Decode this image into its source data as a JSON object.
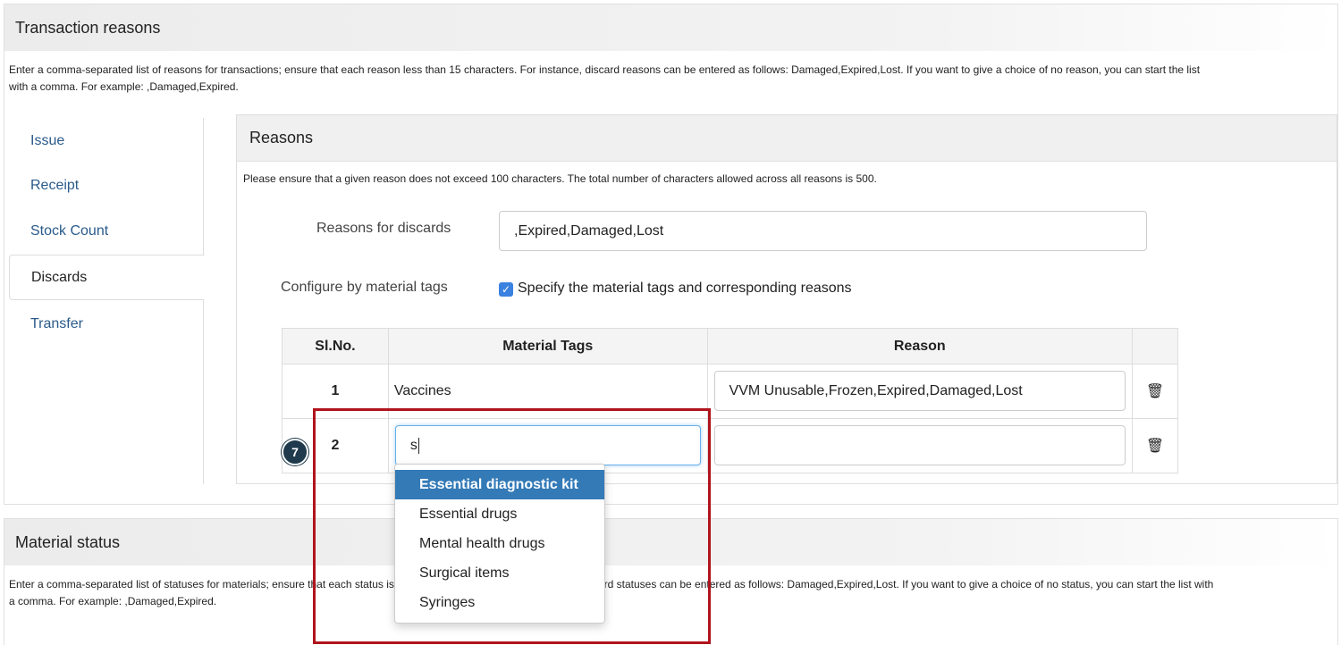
{
  "transaction_reasons": {
    "title": "Transaction reasons",
    "description": "Enter a comma-separated list of reasons for transactions; ensure that each reason less than 15 characters. For instance, discard reasons can be entered as follows: Damaged,Expired,Lost. If you want to give a choice of no reason, you can start the list with a comma. For example: ,Damaged,Expired."
  },
  "side_tabs": [
    {
      "label": "Issue"
    },
    {
      "label": "Receipt"
    },
    {
      "label": "Stock Count"
    },
    {
      "label": "Discards",
      "active": true
    },
    {
      "label": "Transfer"
    }
  ],
  "reasons_panel": {
    "title": "Reasons",
    "note": "Please ensure that a given reason does not exceed 100 characters. The total number of characters allowed across all reasons is 500.",
    "discards_label": "Reasons for discards",
    "discards_value": ",Expired,Damaged,Lost",
    "configure_label": "Configure by material tags",
    "configure_checkbox_label": "Specify the material tags and corresponding reasons",
    "configure_checked": true
  },
  "table": {
    "headers": [
      "Sl.No.",
      "Material Tags",
      "Reason",
      ""
    ],
    "rows": [
      {
        "num": "1",
        "tag": "Vaccines",
        "reason": "VVM Unusable,Frozen,Expired,Damaged,Lost"
      },
      {
        "num": "2",
        "tag": "s",
        "reason": ""
      }
    ]
  },
  "autocomplete": {
    "items": [
      "Essential diagnostic kit",
      "Essential drugs",
      "Mental health drugs",
      "Surgical items",
      "Syringes"
    ],
    "active_index": 0
  },
  "step_badge": "7",
  "material_status": {
    "title": "Material status",
    "description": "Enter a comma-separated list of statuses for materials; ensure that each status is less than 15 characters. For instance, discard statuses can be entered as follows: Damaged,Expired,Lost. If you want to give a choice of no status, you can start the list with a comma. For example: ,Damaged,Expired."
  },
  "colors": {
    "highlight": "#b0141c",
    "dropdown_active": "#337ab7",
    "tab_link": "#2a5a8a"
  }
}
